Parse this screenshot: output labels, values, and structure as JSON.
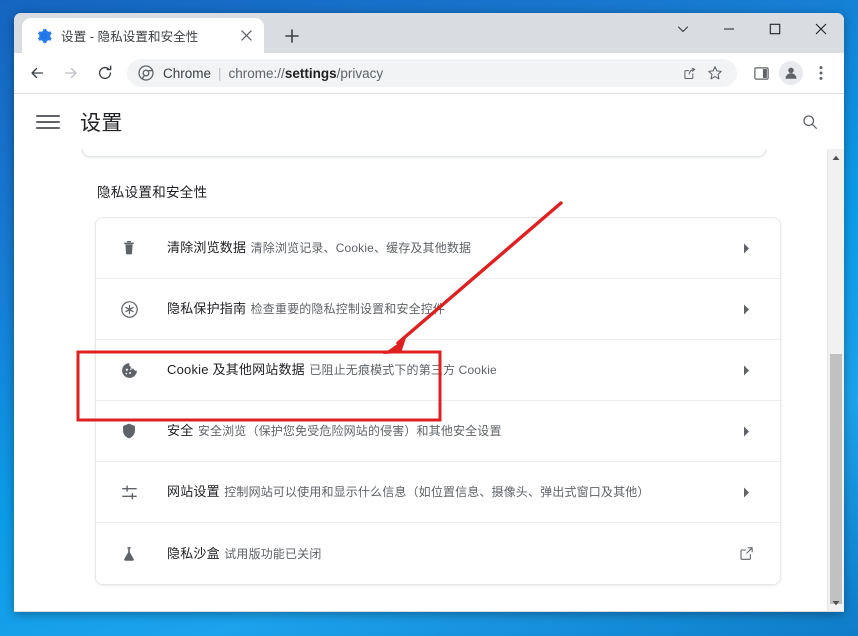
{
  "window": {
    "controls": {
      "chevron_down": "chevron-down",
      "minimize": "—",
      "maximize": "□",
      "close": "✕"
    }
  },
  "tabstrip": {
    "tab": {
      "favicon": "gear-icon-blue",
      "title": "设置 - 隐私设置和安全性",
      "close_label": "✕"
    },
    "new_tab_label": "+"
  },
  "toolbar": {
    "back_icon": "back-arrow-icon",
    "forward_icon": "forward-arrow-icon",
    "reload_icon": "reload-icon",
    "omnibox": {
      "site_icon": "chrome-logo-icon",
      "scheme_label": "Chrome",
      "separator": "|",
      "url_prefix": "chrome://",
      "url_bold": "settings",
      "url_suffix": "/privacy",
      "full_url": "chrome://settings/privacy",
      "share_icon": "share-icon",
      "bookmark_icon": "star-icon"
    },
    "side_panel_icon": "side-panel-icon",
    "profile_icon": "account-avatar-icon",
    "menu_icon": "three-dot-menu-icon"
  },
  "settings": {
    "menu_icon": "hamburger-menu-icon",
    "title": "设置",
    "search_icon": "search-icon",
    "section_title": "隐私设置和安全性",
    "rows": [
      {
        "icon": "trash-icon",
        "title": "清除浏览数据",
        "subtitle": "清除浏览记录、Cookie、缓存及其他数据",
        "action": "chevron-right-icon"
      },
      {
        "icon": "privacy-guide-icon",
        "title": "隐私保护指南",
        "subtitle": "检查重要的隐私控制设置和安全控件",
        "action": "chevron-right-icon"
      },
      {
        "icon": "cookie-icon",
        "title": "Cookie 及其他网站数据",
        "subtitle": "已阻止无痕模式下的第三方 Cookie",
        "action": "chevron-right-icon"
      },
      {
        "icon": "shield-icon",
        "title": "安全",
        "subtitle": "安全浏览（保护您免受危险网站的侵害）和其他安全设置",
        "action": "chevron-right-icon"
      },
      {
        "icon": "sliders-icon",
        "title": "网站设置",
        "subtitle": "控制网站可以使用和显示什么信息（如位置信息、摄像头、弹出式窗口及其他）",
        "action": "chevron-right-icon"
      },
      {
        "icon": "flask-icon",
        "title": "隐私沙盒",
        "subtitle": "试用版功能已关闭",
        "action": "external-link-icon"
      }
    ]
  },
  "scrollbar": {
    "up_arrow": "scroll-up-arrow-icon",
    "down_arrow": "scroll-down-arrow-icon"
  },
  "annotations": {
    "highlight_color": "#E02020",
    "arrow_color": "#E02020",
    "highlighted_row_index": 2
  }
}
